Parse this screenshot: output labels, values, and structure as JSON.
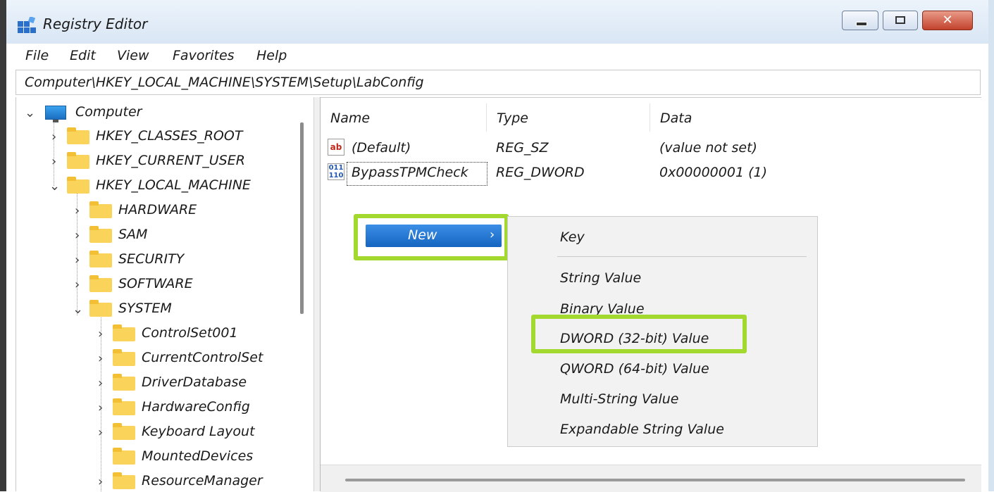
{
  "window": {
    "title": "Registry Editor",
    "close_glyph": "✕"
  },
  "menu": [
    "File",
    "Edit",
    "View",
    "Favorites",
    "Help"
  ],
  "address": "Computer\\HKEY_LOCAL_MACHINE\\SYSTEM\\Setup\\LabConfig",
  "tree": {
    "root": "Computer",
    "hives": [
      "HKEY_CLASSES_ROOT",
      "HKEY_CURRENT_USER",
      "HKEY_LOCAL_MACHINE"
    ],
    "hklm_children": [
      "HARDWARE",
      "SAM",
      "SECURITY",
      "SOFTWARE",
      "SYSTEM"
    ],
    "system_children": [
      "ControlSet001",
      "CurrentControlSet",
      "DriverDatabase",
      "HardwareConfig",
      "Keyboard Layout",
      "MountedDevices",
      "ResourceManager"
    ]
  },
  "list": {
    "columns": [
      "Name",
      "Type",
      "Data"
    ],
    "rows": [
      {
        "icon": "string-value-icon",
        "glyph": "ab",
        "name": "(Default)",
        "type": "REG_SZ",
        "data": "(value not set)"
      },
      {
        "icon": "binary-value-icon",
        "glyph": "011\n110",
        "name": "BypassTPMCheck",
        "type": "REG_DWORD",
        "data": "0x00000001 (1)"
      }
    ]
  },
  "context_menu": {
    "new_label": "New",
    "arrow": "›",
    "submenu": [
      "Key",
      "String Value",
      "Binary Value",
      "DWORD (32-bit) Value",
      "QWORD (64-bit) Value",
      "Multi-String Value",
      "Expandable String Value"
    ]
  },
  "colors": {
    "highlight": "#a3d92f",
    "menu_selection": "#1565c0"
  }
}
